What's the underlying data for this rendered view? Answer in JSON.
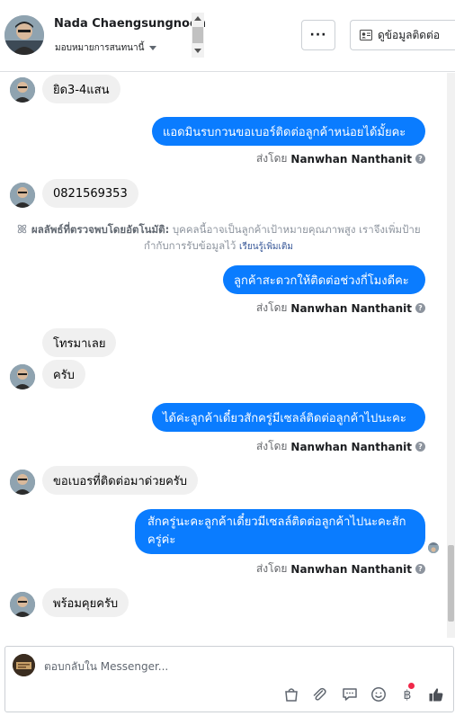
{
  "header": {
    "contact_name": "Nada Chaengsungnoen",
    "assign_label": "มอบหมายการสนทนานี้",
    "more_label": "···",
    "contact_info_label": "ดูข้อมูลติดต่อ"
  },
  "messages": {
    "m1": "ยิด3-4แสน",
    "m2": "แอดมินรบกวนขอเบอร์ติดต่อลูกค้าหน่อยได้มั้ยคะ",
    "m3": "0821569353",
    "m4": "ลูกค้าสะดวกให้ติดต่อช่วงกี่โมงดีคะ",
    "m5": "โทรมาเลย",
    "m6": "ครับ",
    "m7": "ได้ค่ะลูกค้าเดี๋ยวสักครู่มีเซลล์ติดต่อลูกค้าไปนะคะ",
    "m8": "ขอเบอรที่ติดต่อมาด่วยครับ",
    "m9": "สักครู่นะคะลูกค้าเดี๋ยวมีเซลล์ติดต่อลูกค้าไปนะคะสักครู่ค่ะ",
    "m10": "พร้อมคุยครับ"
  },
  "sent_by": {
    "prefix": "ส่งโดย",
    "name": "Nanwhan Nanthanit"
  },
  "auto_detect": {
    "title": "ผลลัพธ์ที่ตรวจพบโดยอัตโนมัติ:",
    "text": "บุคคลนี้อาจเป็นลูกค้าเป้าหมายคุณภาพสูง เราจึงเพิ่มป้ายกำกับการรับข้อมูลไว้",
    "learn_more": "เรียนรู้เพิ่มเติม"
  },
  "composer": {
    "placeholder": "ตอบกลับใน Messenger..."
  },
  "icons": {
    "bag": "shopping-bag-icon",
    "attach": "paperclip-icon",
    "saved_reply": "chat-bubble-icon",
    "emoji": "smiley-icon",
    "payment": "baht-icon",
    "like": "thumbs-up-icon"
  },
  "colors": {
    "outgoing_bubble": "#0a7cff",
    "incoming_bubble": "#f0f0f0",
    "notification_dot": "#f02849"
  }
}
